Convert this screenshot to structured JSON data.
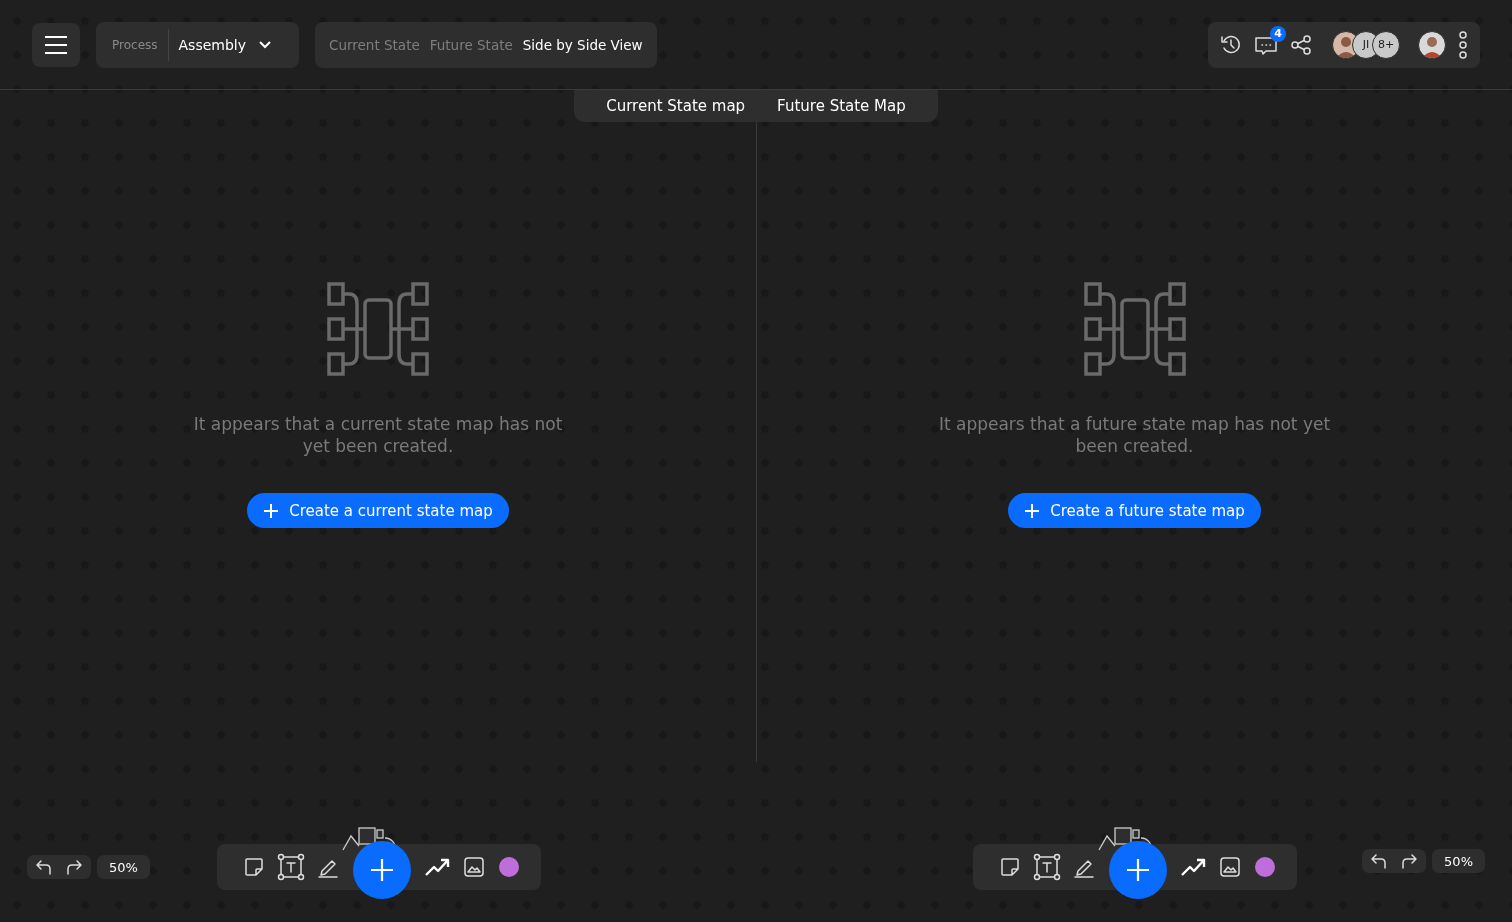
{
  "header": {
    "process_label": "Process",
    "process_value": "Assembly",
    "view_tabs": [
      {
        "label": "Current State",
        "selected": false
      },
      {
        "label": "Future State",
        "selected": false
      },
      {
        "label": "Side by Side View",
        "selected": true
      }
    ],
    "comment_badge": "4",
    "avatars": [
      {
        "kind": "photo"
      },
      {
        "kind": "initials",
        "text": "JI"
      },
      {
        "kind": "count",
        "text": "8+"
      }
    ]
  },
  "map_tabs": [
    "Current State map",
    "Future State Map"
  ],
  "panes": [
    {
      "message": "It appears that a current state map has not yet been created.",
      "button": "Create a current state map",
      "zoom": "50%"
    },
    {
      "message": "It appears that a future state map has not yet been created.",
      "button": "Create a future state map",
      "zoom": "50%"
    }
  ]
}
